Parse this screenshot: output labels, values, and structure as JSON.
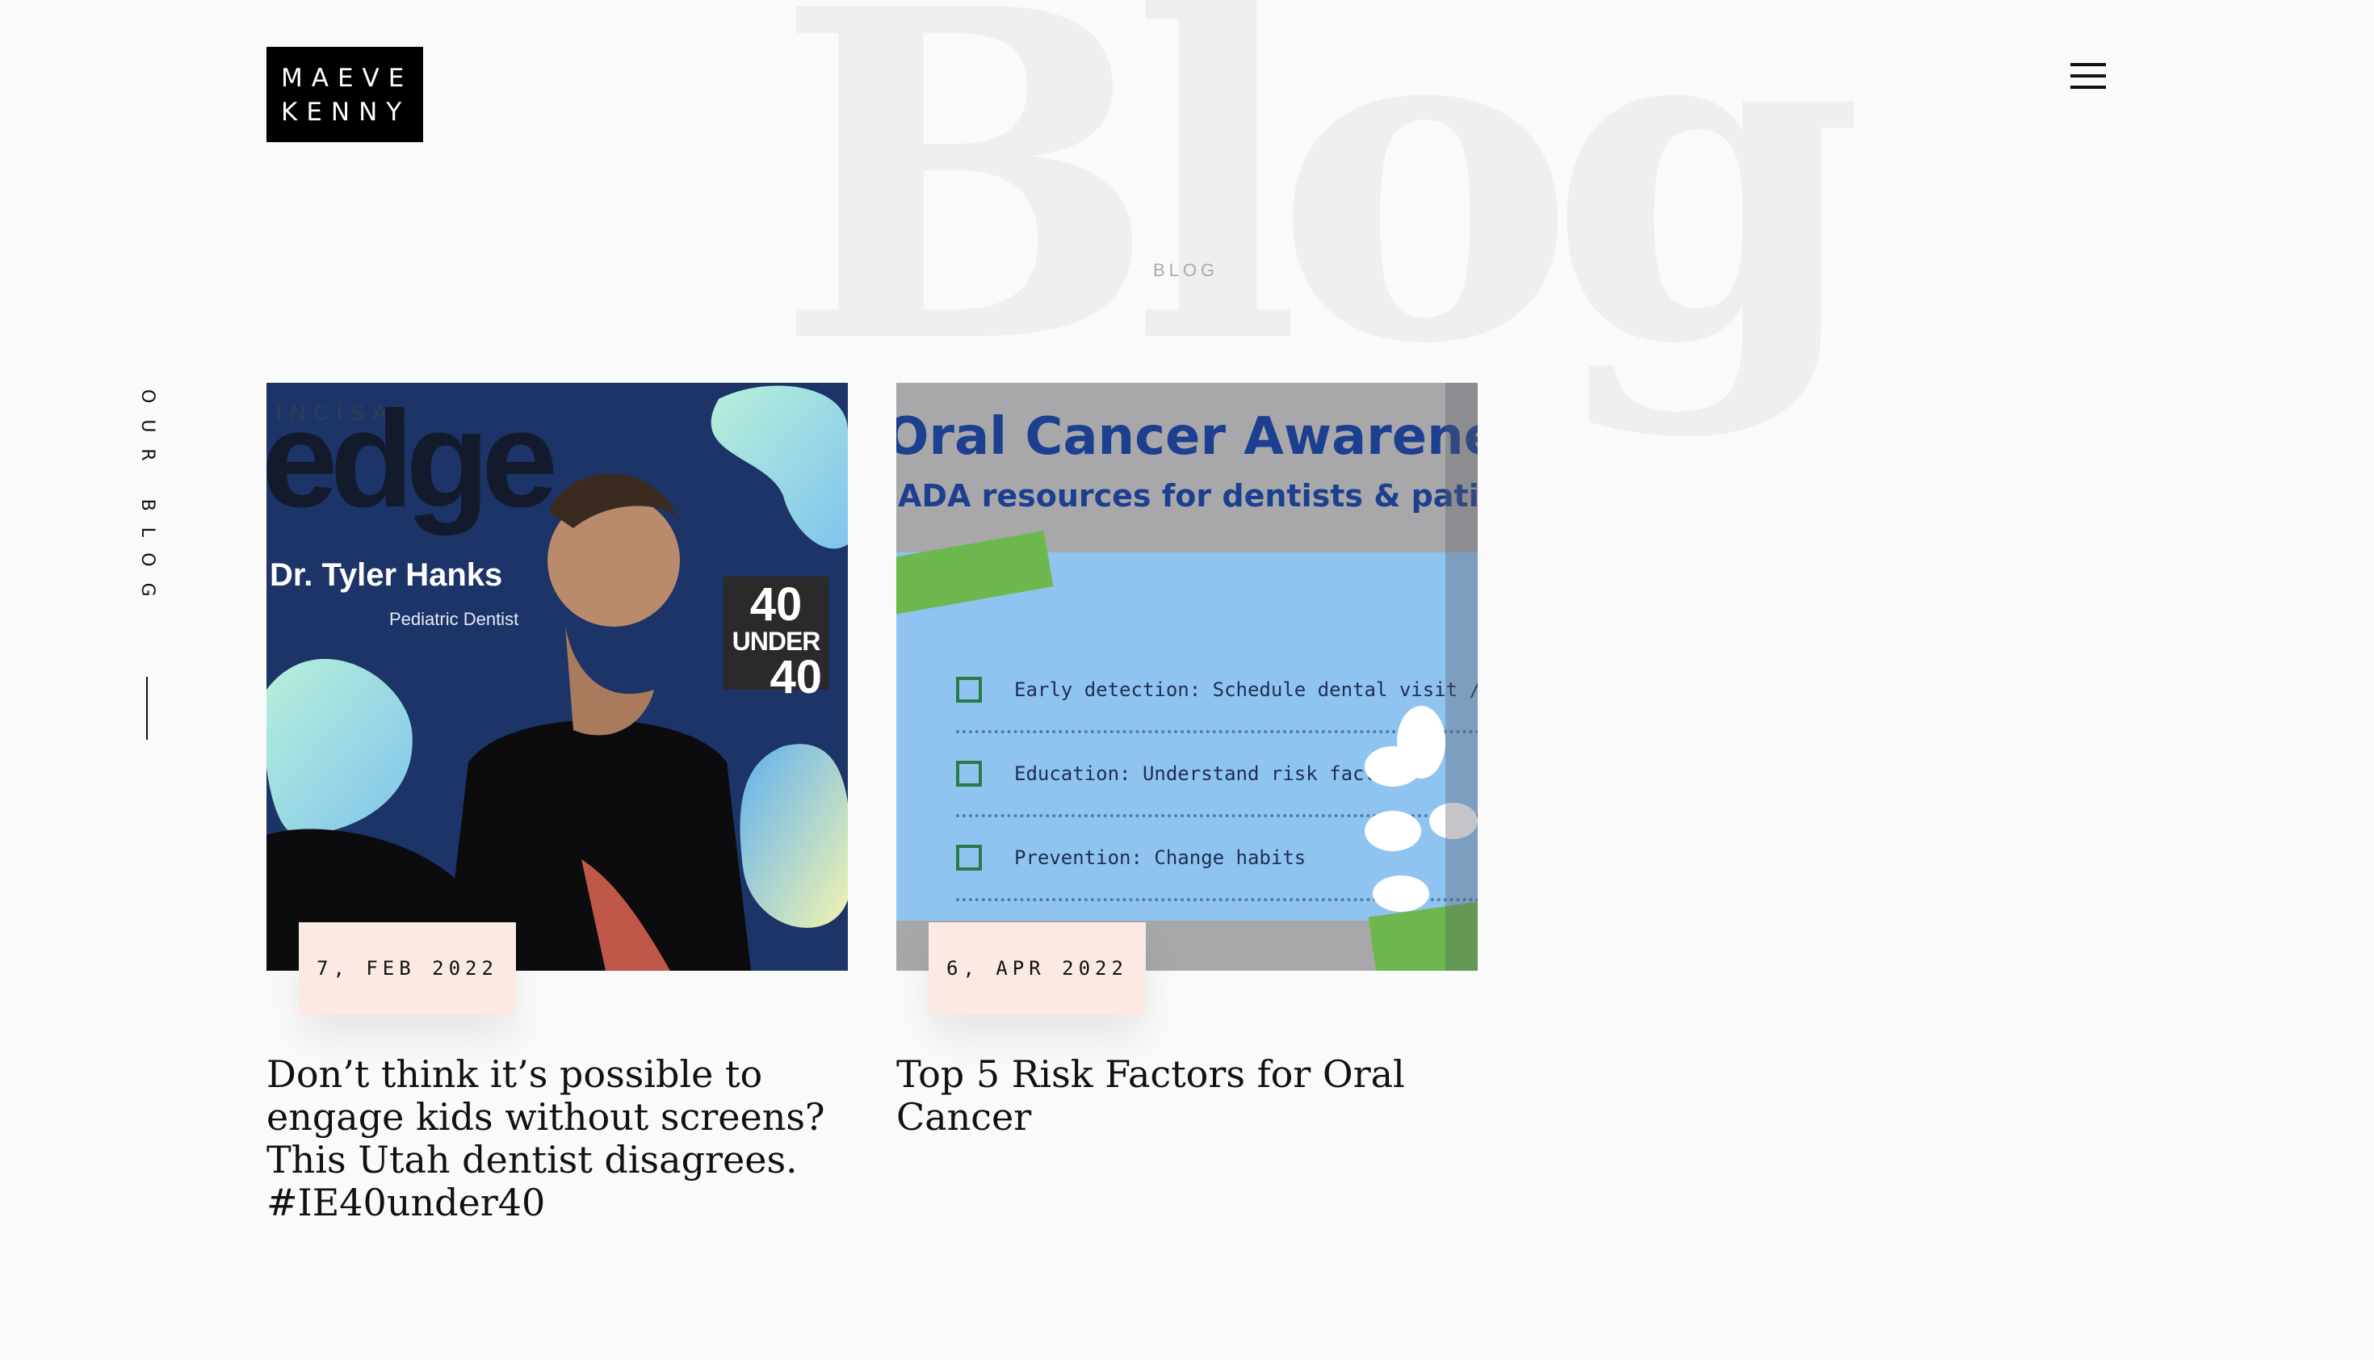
{
  "brand": {
    "line1": "MAEVE",
    "line2": "KENNY"
  },
  "header": {
    "watermark": "Blog",
    "page_label": "BLOG",
    "menu_icon": "hamburger-menu-icon"
  },
  "sidebar": {
    "label": "OUR BLOG"
  },
  "posts": [
    {
      "date": "7, FEB 2022",
      "title": "Don’t think it’s possible to engage kids without screens? This Utah dentist disagrees. #IE40under40",
      "thumbnail": {
        "magazine_small": "INCISAL",
        "magazine": "edge",
        "person": "Dr. Tyler Hanks",
        "role": "Pediatric Dentist",
        "badge_top": "40",
        "badge_mid": "UNDER",
        "badge_bottom": "40"
      }
    },
    {
      "date": "6, APR 2022",
      "title": "Top 5 Risk Factors for Oral Cancer",
      "thumbnail": {
        "heading": "Oral Cancer Awareness",
        "subheading": "ADA resources for dentists & patients",
        "items": [
          "Early detection: Schedule dental visit /oral exam",
          "Education: Understand risk factors",
          "Prevention: Change habits"
        ]
      }
    }
  ],
  "colors": {
    "background": "#fafafa",
    "date_badge": "#fbe9e3",
    "watermark": "#efefef"
  }
}
